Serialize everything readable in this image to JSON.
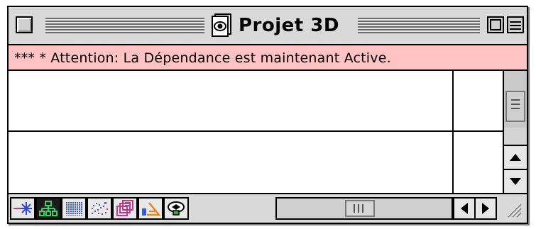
{
  "window": {
    "title": "Projet 3D",
    "title_icon": "document-eye-icon"
  },
  "message": {
    "text": "*** * Attention: La Dépendance est maintenant Active."
  },
  "toolbar": {
    "tools": [
      {
        "name": "snap-point-tool",
        "icon": "asterisk-line-icon"
      },
      {
        "name": "hierarchy-tool",
        "icon": "tree-diagram-icon",
        "selected": true
      },
      {
        "name": "grid-fill-tool",
        "icon": "dot-grid-icon"
      },
      {
        "name": "scatter-tool",
        "icon": "scatter-dots-icon"
      },
      {
        "name": "stack-tool",
        "icon": "stacked-frames-icon"
      },
      {
        "name": "angle-tool",
        "icon": "angle-measure-icon"
      },
      {
        "name": "view-3d-tool",
        "icon": "3d-object-icon"
      }
    ]
  },
  "colors": {
    "message_bg": "#ffc3c3",
    "window_gray": "#d9d9d9"
  }
}
